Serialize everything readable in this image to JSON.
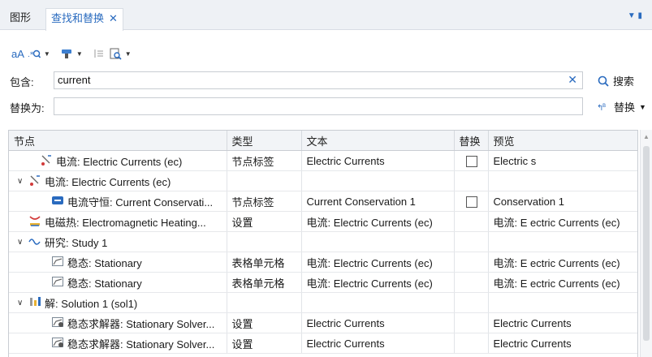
{
  "tabs": [
    {
      "label": "图形",
      "active": false
    },
    {
      "label": "查找和替换",
      "active": true,
      "close": "✕"
    }
  ],
  "toolbar": {
    "match_case_label": "aA",
    "icons": [
      "match-case-icon",
      "regex-search-icon",
      "filter-icon",
      "text-node-icon",
      "search-in-icon"
    ]
  },
  "contains": {
    "label": "包含:",
    "value": "current",
    "clear": "✕",
    "search_label": "搜索"
  },
  "replace": {
    "label": "替换为:",
    "value": "",
    "replace_label": "替换"
  },
  "table": {
    "columns": [
      "节点",
      "类型",
      "文本",
      "替换",
      "预览"
    ],
    "rows": [
      {
        "indent": 1,
        "expand": "",
        "icon": "physics-icon",
        "node": "电流: Electric Currents (ec)",
        "type": "节点标签",
        "text": "Electric Currents",
        "checkbox": true,
        "preview": "Electric s"
      },
      {
        "indent": 0,
        "expand": "∨",
        "icon": "physics-icon",
        "node": "电流: Electric Currents (ec)",
        "type": "",
        "text": "",
        "checkbox": false,
        "preview": ""
      },
      {
        "indent": 2,
        "expand": "",
        "icon": "conservation-icon",
        "node": "电流守恒: Current Conservati...",
        "type": "节点标签",
        "text": "Current Conservation 1",
        "checkbox": true,
        "preview": "Conservation 1"
      },
      {
        "indent": 0,
        "expand": "",
        "icon": "multiphysics-icon",
        "node": "电磁热: Electromagnetic Heating...",
        "type": "设置",
        "text": "电流: Electric Currents (ec)",
        "checkbox": false,
        "preview": "电流: E ectric Currents (ec)"
      },
      {
        "indent": 0,
        "expand": "∨",
        "icon": "study-icon",
        "node": "研究: Study 1",
        "type": "",
        "text": "",
        "checkbox": false,
        "preview": ""
      },
      {
        "indent": 2,
        "expand": "",
        "icon": "stationary-icon",
        "node": "稳态: Stationary",
        "type": "表格单元格",
        "text": "电流: Electric Currents (ec)",
        "checkbox": false,
        "preview": "电流: E ectric Currents (ec)"
      },
      {
        "indent": 2,
        "expand": "",
        "icon": "stationary-icon",
        "node": "稳态: Stationary",
        "type": "表格单元格",
        "text": "电流: Electric Currents (ec)",
        "checkbox": false,
        "preview": "电流: E ectric Currents (ec)"
      },
      {
        "indent": 0,
        "expand": "∨",
        "icon": "solution-icon",
        "node": "解: Solution 1 (sol1)",
        "type": "",
        "text": "",
        "checkbox": false,
        "preview": ""
      },
      {
        "indent": 2,
        "expand": "",
        "icon": "solver-icon",
        "node": "稳态求解器: Stationary Solver...",
        "type": "设置",
        "text": "Electric Currents",
        "checkbox": false,
        "preview": "Electric Currents"
      },
      {
        "indent": 2,
        "expand": "",
        "icon": "solver-icon",
        "node": "稳态求解器: Stationary Solver...",
        "type": "设置",
        "text": "Electric Currents",
        "checkbox": false,
        "preview": "Electric Currents"
      }
    ]
  },
  "colors": {
    "accent": "#2a6bbf",
    "tabbar": "#eef1f5",
    "header": "#f2f4f7"
  }
}
